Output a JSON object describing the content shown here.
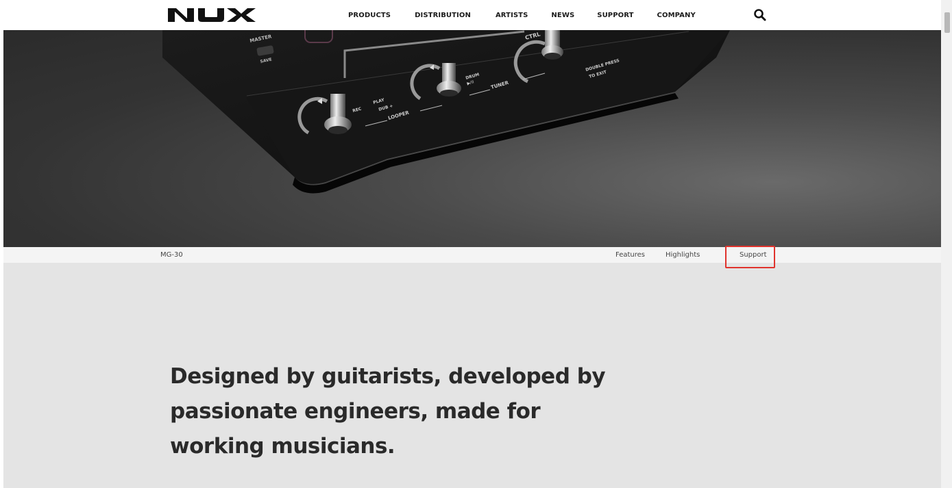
{
  "header": {
    "logo_text": "NUX",
    "nav": [
      "PRODUCTS",
      "DISTRIBUTION",
      "ARTISTS",
      "NEWS",
      "SUPPORT",
      "COMPANY"
    ],
    "search_icon": "search-icon"
  },
  "hero": {
    "device_labels": {
      "master": "MASTER",
      "save": "SAVE",
      "ctrl": "CTRL",
      "double_press": "DOUBLE PRESS",
      "to_exit": "TO EXIT",
      "rec": "REC",
      "play": "PLAY",
      "dub": "DUB +",
      "looper": "LOOPER",
      "drum": "DRUM",
      "drum_sub": "▶/II",
      "tuner": "TUNER"
    }
  },
  "subnav": {
    "product_name": "MG-30",
    "links": [
      "Features",
      "Highlights",
      "Support"
    ],
    "highlight_color": "#e0322c"
  },
  "main": {
    "headline_lines": [
      "Designed by guitarists, developed by",
      "passionate engineers, made for",
      "working musicians."
    ]
  }
}
